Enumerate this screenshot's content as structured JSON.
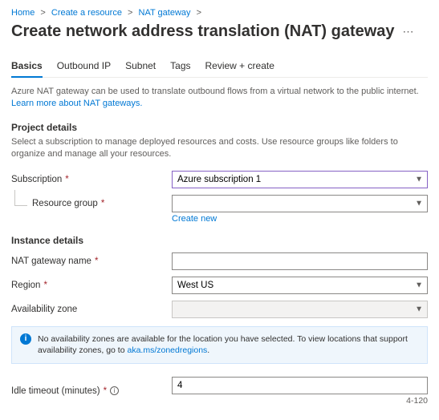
{
  "breadcrumb": {
    "home": "Home",
    "create_resource": "Create a resource",
    "nat_gateway": "NAT gateway"
  },
  "page_title": "Create network address translation (NAT) gateway",
  "tabs": {
    "basics": "Basics",
    "outbound_ip": "Outbound IP",
    "subnet": "Subnet",
    "tags": "Tags",
    "review": "Review + create"
  },
  "intro": {
    "text": "Azure NAT gateway can be used to translate outbound flows from a virtual network to the public internet.",
    "link": "Learn more about NAT gateways."
  },
  "project": {
    "title": "Project details",
    "desc": "Select a subscription to manage deployed resources and costs. Use resource groups like folders to organize and manage all your resources.",
    "subscription_label": "Subscription",
    "subscription_value": "Azure subscription 1",
    "resource_group_label": "Resource group",
    "resource_group_value": "",
    "create_new": "Create new"
  },
  "instance": {
    "title": "Instance details",
    "name_label": "NAT gateway name",
    "name_value": "",
    "region_label": "Region",
    "region_value": "West US",
    "az_label": "Availability zone",
    "az_value": ""
  },
  "info": {
    "text": "No availability zones are available for the location you have selected. To view locations that support availability zones, go to ",
    "link": "aka.ms/zonedregions"
  },
  "idle": {
    "label": "Idle timeout (minutes)",
    "value": "4",
    "range": "4-120"
  }
}
